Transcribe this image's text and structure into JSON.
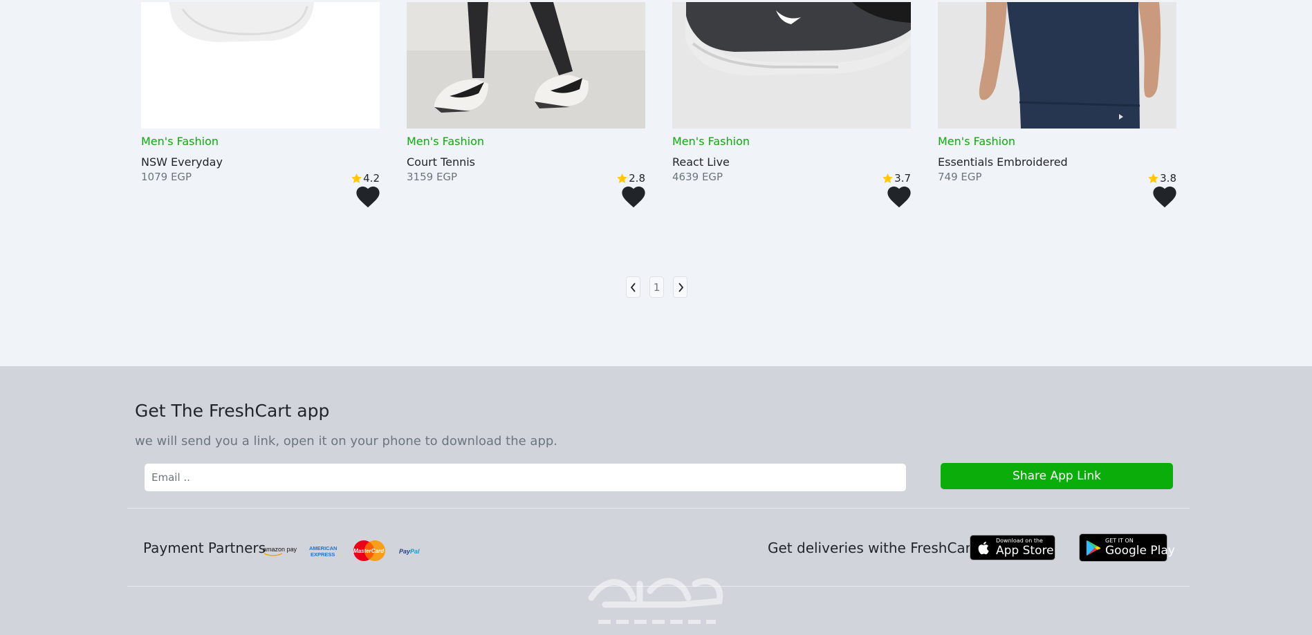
{
  "products": [
    {
      "category": "Men's Fashion",
      "name": "NSW Everyday",
      "price": "1079 EGP",
      "rating": "4.2",
      "image": "white-socks"
    },
    {
      "category": "Men's Fashion",
      "name": "Court Tennis",
      "price": "3159 EGP",
      "rating": "2.8",
      "image": "sneakers-worn"
    },
    {
      "category": "Men's Fashion",
      "name": "React Live",
      "price": "4639 EGP",
      "rating": "3.7",
      "image": "grey-running-shoe"
    },
    {
      "category": "Men's Fashion",
      "name": "Essentials Embroidered",
      "price": "749 EGP",
      "rating": "3.8",
      "image": "navy-tshirt"
    }
  ],
  "pagination": {
    "current_page": "1"
  },
  "footer": {
    "title": "Get The FreshCart app",
    "subtitle": "we will send you a link, open it on your phone to download the app.",
    "email_placeholder": "Email ..",
    "share_button": "Share App Link",
    "payment_label": "Payment Partners",
    "payment_partners": [
      "amazon pay",
      "American Express",
      "MasterCard",
      "PayPal"
    ],
    "deliveries_label": "Get deliveries withe FreshCart",
    "app_store": {
      "small": "Download on the",
      "big": "App Store"
    },
    "google_play": {
      "small": "GET IT ON",
      "big": "Google Play"
    }
  },
  "colors": {
    "accent": "#0aad0a",
    "page_background": "#f0f3f7",
    "footer_background": "#d1d5db",
    "star": "#ffc908",
    "heart": "#212529"
  }
}
